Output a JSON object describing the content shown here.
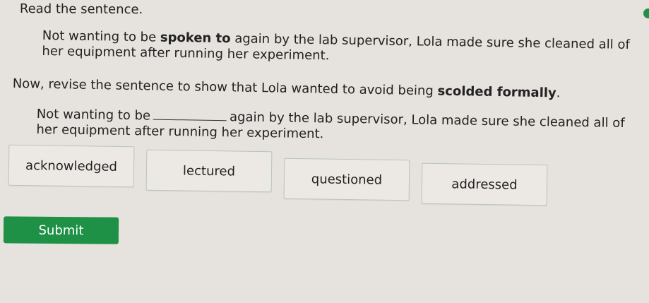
{
  "prompt": "Read the sentence.",
  "sentence": {
    "part1": "Not wanting to be ",
    "bold": "spoken to",
    "part2": " again by the lab supervisor, Lola made sure she cleaned all of her equipment after running her experiment."
  },
  "instruction": {
    "part1": "Now, revise the sentence to show that Lola wanted to avoid being ",
    "bold": "scolded formally",
    "part2": "."
  },
  "revised": {
    "part1": "Not wanting to be",
    "part2": "again by the lab supervisor, Lola made sure she cleaned all of her equipment after running her experiment."
  },
  "choices": [
    "acknowledged",
    "lectured",
    "questioned",
    "addressed"
  ],
  "submit_label": "Submit",
  "colors": {
    "submit": "#1e9146",
    "background": "#e6e2dd"
  }
}
